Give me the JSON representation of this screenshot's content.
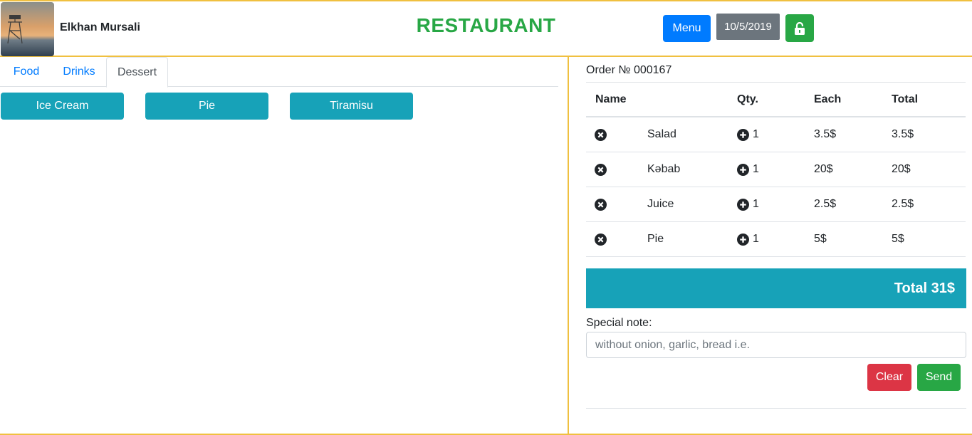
{
  "header": {
    "username": "Elkhan Mursali",
    "title": "RESTAURANT",
    "menu_label": "Menu",
    "date": "10/5/2019",
    "lock_icon": "unlock-icon"
  },
  "tabs": [
    {
      "label": "Food",
      "active": false
    },
    {
      "label": "Drinks",
      "active": false
    },
    {
      "label": "Dessert",
      "active": true
    }
  ],
  "items": [
    "Ice Cream",
    "Pie",
    "Tiramisu"
  ],
  "order": {
    "number_label": "Order № 000167",
    "columns": {
      "name": "Name",
      "qty": "Qty.",
      "each": "Each",
      "total": "Total"
    },
    "rows": [
      {
        "name": "Salad",
        "qty": "1",
        "each": "3.5$",
        "total": "3.5$"
      },
      {
        "name": "Kəbab",
        "qty": "1",
        "each": "20$",
        "total": "20$"
      },
      {
        "name": "Juice",
        "qty": "1",
        "each": "2.5$",
        "total": "2.5$"
      },
      {
        "name": "Pie",
        "qty": "1",
        "each": "5$",
        "total": "5$"
      }
    ],
    "total_label": "Total 31$"
  },
  "note": {
    "label": "Special note:",
    "placeholder": "without onion, garlic, bread i.e.",
    "value": ""
  },
  "actions": {
    "clear": "Clear",
    "send": "Send"
  },
  "colors": {
    "accent_border": "#f0c040",
    "title_green": "#28a745",
    "primary": "#007bff",
    "info": "#17a2b8",
    "danger": "#dc3545",
    "secondary": "#6c757d"
  }
}
